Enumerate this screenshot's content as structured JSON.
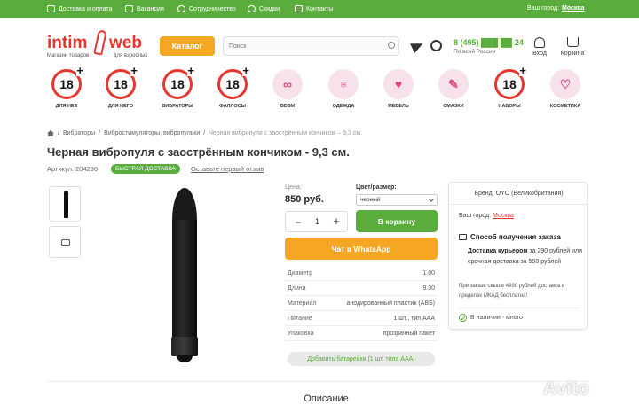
{
  "topbar": {
    "links": [
      "Доставка и оплата",
      "Вакансии",
      "Сотрудничество",
      "Скидки",
      "Контакты"
    ],
    "city_label": "Ваш город:",
    "city": "Москва"
  },
  "logo": {
    "part1": "intim",
    "part2": "web",
    "tagline1": "Магазин товаров",
    "tagline2": "для взрослых"
  },
  "header": {
    "catalog_label": "Каталог",
    "search_placeholder": "Поиск",
    "phone": "8 (495) ███-██-24",
    "phone_sub": "По всей России",
    "login_label": "Вход",
    "cart_label": "Корзина"
  },
  "categories": [
    {
      "label": "ДЛЯ НЕЕ",
      "badge": "18",
      "icon": "age-18-icon"
    },
    {
      "label": "ДЛЯ НЕГО",
      "badge": "18",
      "icon": "age-18-icon"
    },
    {
      "label": "ВИБРАТОРЫ",
      "badge": "18",
      "icon": "age-18-icon"
    },
    {
      "label": "ФАЛЛОСЫ",
      "badge": "18",
      "icon": "age-18-icon"
    },
    {
      "label": "BDSM",
      "badge": "",
      "icon": "handcuffs-icon"
    },
    {
      "label": "ОДЕЖДА",
      "badge": "",
      "icon": "bunny-ears-icon"
    },
    {
      "label": "МЕБЕЛЬ",
      "badge": "",
      "icon": "bed-icon"
    },
    {
      "label": "СМАЗКИ",
      "badge": "",
      "icon": "tube-icon"
    },
    {
      "label": "НАБОРЫ",
      "badge": "18",
      "icon": "age-18-icon"
    },
    {
      "label": "КОСМЕТИКА",
      "badge": "",
      "icon": "lipstick-icon"
    }
  ],
  "breadcrumb": {
    "items": [
      "Вибраторы",
      "Вибростимуляторы, вибропульки"
    ],
    "current": "Черная вибропуля с заострённым кончиком – 9,3 см."
  },
  "product": {
    "title": "Черная вибропуля с заострённым кончиком - 9,3 см.",
    "sku": "Артикул: 204236",
    "fast_badge": "БЫСТРАЯ ДОСТАВКА",
    "review_link": "Оставьте первый отзыв",
    "price_label": "Цена:",
    "price": "850 руб.",
    "color_label": "Цвет/размер:",
    "color_value": "черный",
    "quantity": "1",
    "cart_button": "В корзину",
    "whatsapp_button": "Чат в WhatsApp",
    "specs": [
      {
        "key": "Диаметр",
        "value": "1.00"
      },
      {
        "key": "Длина",
        "value": "9.30"
      },
      {
        "key": "Материал",
        "value": "анодированный пластик (ABS)"
      },
      {
        "key": "Питание",
        "value": "1 шт., тип AAA"
      },
      {
        "key": "Упаковка",
        "value": "прозрачный пакет"
      }
    ],
    "battery_button": "Добавить батарейки (1 шт. типа AAA)"
  },
  "sidebar": {
    "brand": "Бренд: OYO (Великобритания)",
    "city_label": "Ваш город:",
    "city": "Москва",
    "delivery_title": "Способ получения заказа",
    "delivery_bold": "Доставка курьером",
    "delivery_rest": " за 290 рублей или срочная доставка за 590 рублей",
    "note": "При заказе свыше 4990 рублей доставка в пределах МКАД бесплатна!",
    "stock": "В наличии - много"
  },
  "description_title": "Описание",
  "watermark": "Avito",
  "colors": {
    "green": "#5aad3c",
    "orange": "#f5a623",
    "red": "#e6372f"
  }
}
